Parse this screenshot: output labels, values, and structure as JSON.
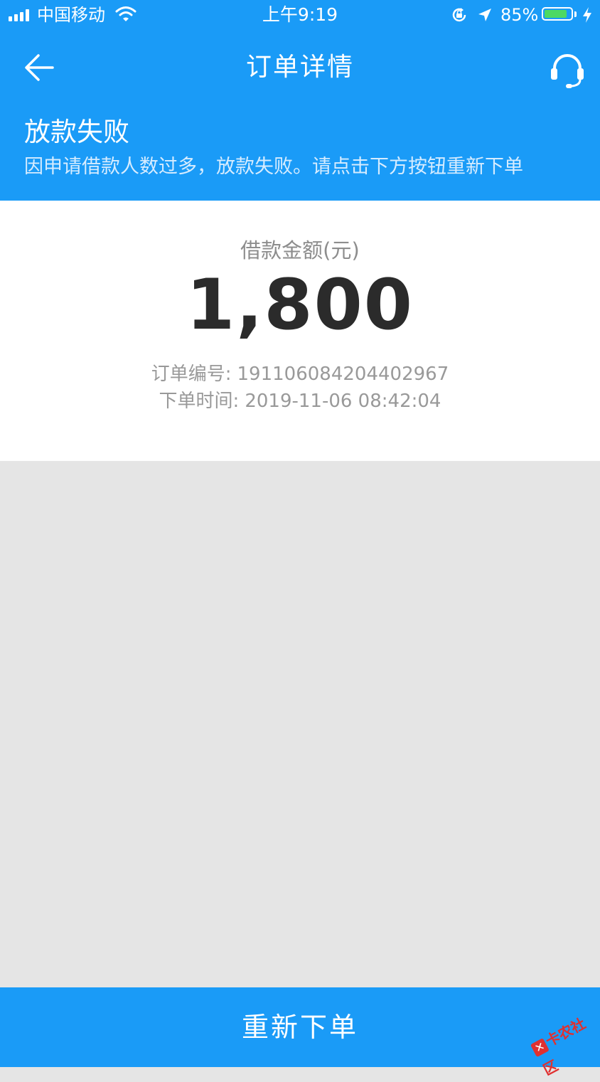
{
  "status_bar": {
    "carrier": "中国移动",
    "time": "上午9:19",
    "battery_percent": "85%",
    "battery_level": 0.85,
    "icons": [
      "signal-icon",
      "wifi-icon",
      "rotation-lock-icon",
      "location-icon",
      "battery-icon",
      "charging-icon"
    ]
  },
  "nav": {
    "title": "订单详情",
    "back_icon": "arrow-left-icon",
    "support_icon": "headset-icon"
  },
  "banner": {
    "title": "放款失败",
    "message": "因申请借款人数过多，放款失败。请点击下方按钮重新下单"
  },
  "order": {
    "amount_label": "借款金额(元)",
    "amount": "1,800",
    "order_no_label": "订单编号:",
    "order_no": "191106084204402967",
    "order_time_label": "下单时间:",
    "order_time": "2019-11-06 08:42:04"
  },
  "footer": {
    "reorder_label": "重新下单"
  },
  "watermark": {
    "text": "卡农社区"
  },
  "colors": {
    "primary": "#1a9bf7",
    "background": "#e5e5e5",
    "battery_fill": "#4cd964"
  }
}
